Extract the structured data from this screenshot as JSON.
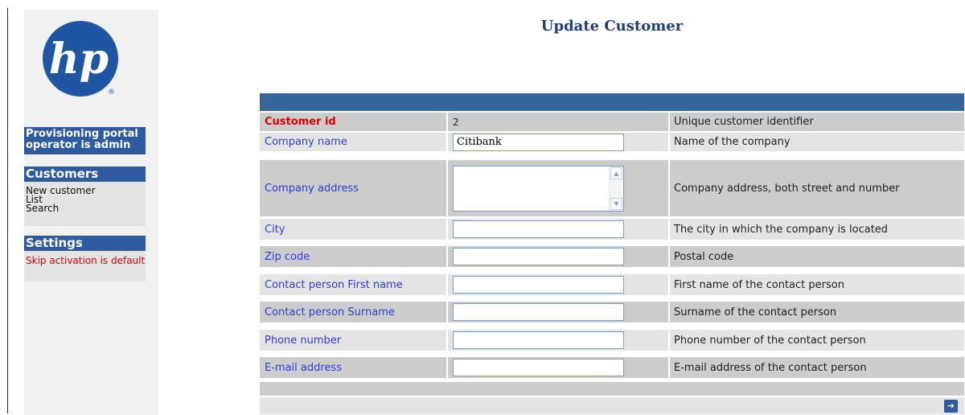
{
  "page": {
    "title": "Update Customer"
  },
  "brand": {
    "logo_text": "hp",
    "logo_color": "#1f56a3",
    "reg_mark": "®"
  },
  "sidebar": {
    "status": "Provisioning portal operator is admin",
    "customers": {
      "heading": "Customers",
      "links": [
        "New customer",
        "List",
        "Search"
      ]
    },
    "settings": {
      "heading": "Settings",
      "note": "Skip activation is default"
    }
  },
  "form": {
    "rows": [
      {
        "label": "Customer id",
        "value": "2",
        "description": "Unique customer identifier"
      },
      {
        "label": "Company name",
        "value": "Citibank",
        "description": "Name of the company"
      },
      {
        "label": "Company address",
        "value": "",
        "description": "Company address, both street and number"
      },
      {
        "label": "City",
        "value": "",
        "description": "The city in which the company is located"
      },
      {
        "label": "Zip code",
        "value": "",
        "description": "Postal code"
      },
      {
        "label": "Contact person First name",
        "value": "",
        "description": "First name of the contact person"
      },
      {
        "label": "Contact person Surname",
        "value": "",
        "description": "Surname of the contact person"
      },
      {
        "label": "Phone number",
        "value": "",
        "description": "Phone number of the contact person"
      },
      {
        "label": "E-mail address",
        "value": "",
        "description": "E-mail address of the contact person"
      }
    ],
    "submit_icon": "arrow-right-icon"
  },
  "colors": {
    "header_bar": "#336699",
    "sidebar_heading": "#2e5aa0",
    "label_blue": "#2e3dd8",
    "label_red": "#e00000",
    "title": "#1f3f7a"
  }
}
